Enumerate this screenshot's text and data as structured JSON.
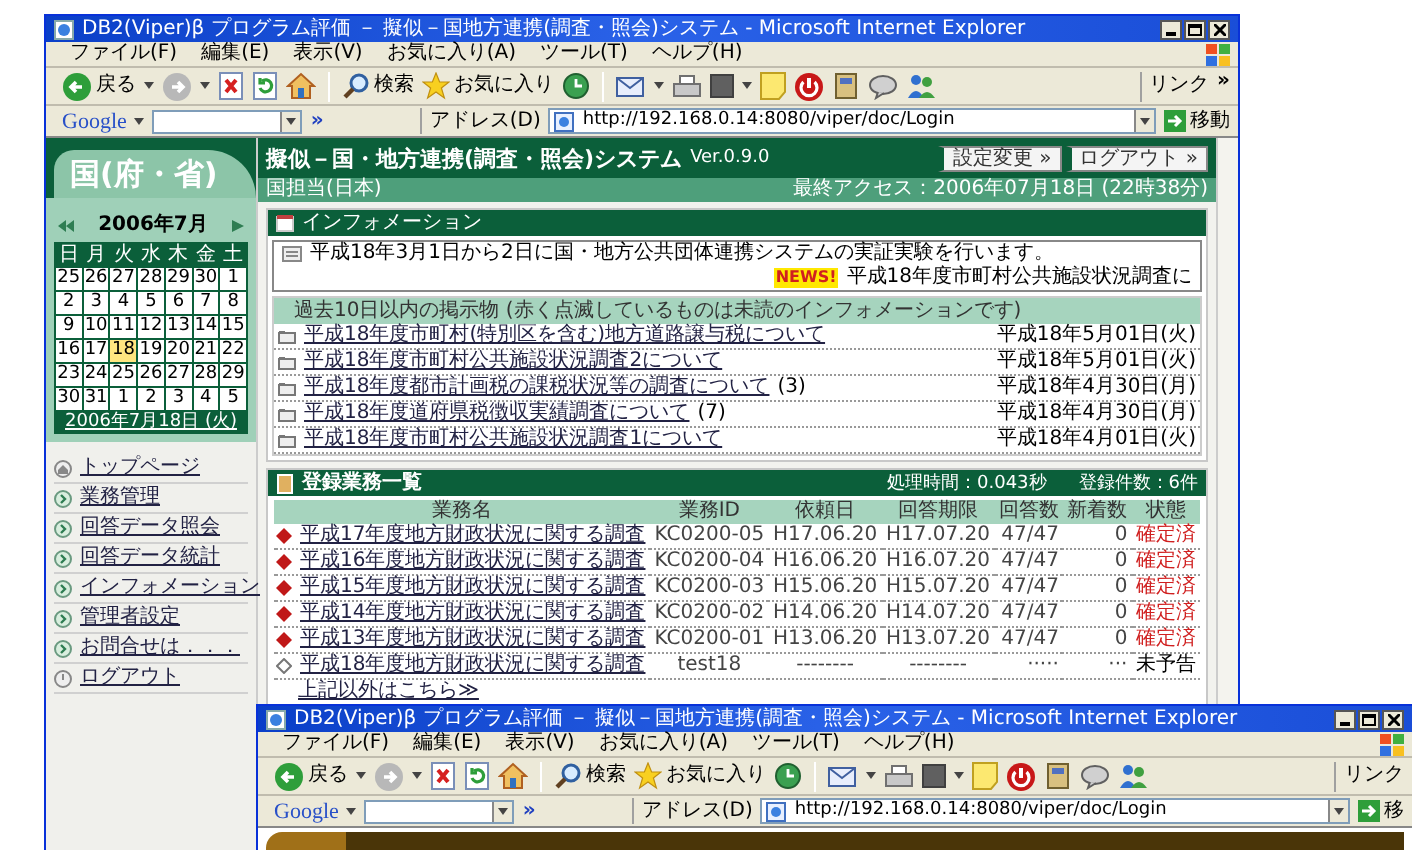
{
  "windows": [
    {
      "title": "DB2(Viper)β プログラム評価 － 擬似－国地方連携(調査・照会)システム - Microsoft Internet Explorer",
      "menu": [
        "ファイル(F)",
        "編集(E)",
        "表示(V)",
        "お気に入り(A)",
        "ツール(T)",
        "ヘルプ(H)"
      ],
      "toolbar": {
        "back": "戻る",
        "search": "検索",
        "favorites": "お気に入り",
        "links": "リンク",
        "links_more": "»"
      },
      "address_bar": {
        "google": "Google",
        "google_more": "»",
        "label": "アドレス(D)",
        "url": "http://192.168.0.14:8080/viper/doc/Login",
        "go": "移動"
      },
      "page": {
        "header": {
          "logo": "国(府・省)",
          "title": "擬似－国・地方連携(調査・照会)システム",
          "version": "Ver.0.9.0",
          "buttons": [
            "設定変更 »",
            "ログアウト »"
          ],
          "section": "国担当(日本)",
          "last_access": "最終アクセス：2006年07月18日 (22時38分)"
        },
        "calendar": {
          "month": "2006年7月",
          "weekdays": [
            "日",
            "月",
            "火",
            "水",
            "木",
            "金",
            "土"
          ],
          "weeks": [
            [
              {
                "day": "25",
                "selected": false
              },
              {
                "day": "26",
                "selected": false
              },
              {
                "day": "27",
                "selected": false
              },
              {
                "day": "28",
                "selected": false
              },
              {
                "day": "29",
                "selected": false
              },
              {
                "day": "30",
                "selected": false
              },
              {
                "day": "1",
                "selected": false
              }
            ],
            [
              {
                "day": "2",
                "selected": false
              },
              {
                "day": "3",
                "selected": false
              },
              {
                "day": "4",
                "selected": false
              },
              {
                "day": "5",
                "selected": false
              },
              {
                "day": "6",
                "selected": false
              },
              {
                "day": "7",
                "selected": false
              },
              {
                "day": "8",
                "selected": false
              }
            ],
            [
              {
                "day": "9",
                "selected": false
              },
              {
                "day": "10",
                "selected": false
              },
              {
                "day": "11",
                "selected": false
              },
              {
                "day": "12",
                "selected": false
              },
              {
                "day": "13",
                "selected": false
              },
              {
                "day": "14",
                "selected": false
              },
              {
                "day": "15",
                "selected": false
              }
            ],
            [
              {
                "day": "16",
                "selected": false
              },
              {
                "day": "17",
                "selected": false
              },
              {
                "day": "18",
                "selected": true
              },
              {
                "day": "19",
                "selected": false
              },
              {
                "day": "20",
                "selected": false
              },
              {
                "day": "21",
                "selected": false
              },
              {
                "day": "22",
                "selected": false
              }
            ],
            [
              {
                "day": "23",
                "selected": false
              },
              {
                "day": "24",
                "selected": false
              },
              {
                "day": "25",
                "selected": false
              },
              {
                "day": "26",
                "selected": false
              },
              {
                "day": "27",
                "selected": false
              },
              {
                "day": "28",
                "selected": false
              },
              {
                "day": "29",
                "selected": false
              }
            ],
            [
              {
                "day": "30",
                "selected": false
              },
              {
                "day": "31",
                "selected": false
              },
              {
                "day": "1",
                "selected": false
              },
              {
                "day": "2",
                "selected": false
              },
              {
                "day": "3",
                "selected": false
              },
              {
                "day": "4",
                "selected": false
              },
              {
                "day": "5",
                "selected": false
              }
            ]
          ],
          "footer": "2006年7月18日 (火)"
        },
        "nav": [
          {
            "label": "トップページ",
            "kind": "home"
          },
          {
            "label": "業務管理",
            "kind": "arrow"
          },
          {
            "label": "回答データ照会",
            "kind": "arrow"
          },
          {
            "label": "回答データ統計",
            "kind": "arrow"
          },
          {
            "label": "インフォメーション",
            "kind": "arrow"
          },
          {
            "label": "管理者設定",
            "kind": "arrow"
          },
          {
            "label": "お問合せは．．．",
            "kind": "arrow"
          },
          {
            "label": "ログアウト",
            "kind": "power"
          }
        ],
        "info": {
          "title": "インフォメーション",
          "notice": "平成18年3月1日から2日に国・地方公共団体連携システムの実証実験を行います。",
          "news_badge": "NEWS!",
          "news": "平成18年度市町村公共施設状況調査に",
          "subtitle": "過去10日以内の掲示物 (赤く点滅しているものは未読のインフォメーションです)",
          "items": [
            {
              "title": "平成18年度市町村(特別区を含む)地方道路譲与税について",
              "date": "平成18年5月01日(火)"
            },
            {
              "title": "平成18年度市町村公共施設状況調査2について",
              "date": "平成18年5月01日(火)"
            },
            {
              "title": "平成18年度都市計画税の課税状況等の調査について",
              "count": "(3)",
              "date": "平成18年4月30日(月)"
            },
            {
              "title": "平成18年度道府県税徴収実績調査について",
              "count": "(7)",
              "date": "平成18年4月30日(月)"
            },
            {
              "title": "平成18年度市町村公共施設状況調査1について",
              "date": "平成18年4月01日(火)"
            }
          ]
        },
        "tasks": {
          "title": "登録業務一覧",
          "time": "処理時間：0.043秒",
          "count": "登録件数：6件",
          "columns": [
            "業務名",
            "業務ID",
            "依頼日",
            "回答期限",
            "回答数",
            "新着数",
            "状態"
          ],
          "rows": [
            {
              "kind": "confirmed",
              "cells": [
                "平成17年度地方財政状況に関する調査",
                "KC0200-05",
                "H17.06.20",
                "H17.07.20",
                "47/47",
                "0",
                "確定済"
              ]
            },
            {
              "kind": "confirmed",
              "cells": [
                "平成16年度地方財政状況に関する調査",
                "KC0200-04",
                "H16.06.20",
                "H16.07.20",
                "47/47",
                "0",
                "確定済"
              ]
            },
            {
              "kind": "confirmed",
              "cells": [
                "平成15年度地方財政状況に関する調査",
                "KC0200-03",
                "H15.06.20",
                "H15.07.20",
                "47/47",
                "0",
                "確定済"
              ]
            },
            {
              "kind": "confirmed",
              "cells": [
                "平成14年度地方財政状況に関する調査",
                "KC0200-02",
                "H14.06.20",
                "H14.07.20",
                "47/47",
                "0",
                "確定済"
              ]
            },
            {
              "kind": "confirmed",
              "cells": [
                "平成13年度地方財政状況に関する調査",
                "KC0200-01",
                "H13.06.20",
                "H13.07.20",
                "47/47",
                "0",
                "確定済"
              ]
            },
            {
              "kind": "unannounced",
              "cells": [
                "平成18年度地方財政状況に関する調査",
                "test18",
                "--------",
                "--------",
                "·····",
                "···",
                "未予告"
              ]
            }
          ],
          "more": "上記以外はこちら≫"
        }
      }
    },
    {
      "title": "DB2(Viper)β プログラム評価 － 擬似－国地方連携(調査・照会)システム - Microsoft Internet Explorer",
      "menu": [
        "ファイル(F)",
        "編集(E)",
        "表示(V)",
        "お気に入り(A)",
        "ツール(T)",
        "ヘルプ(H)"
      ],
      "toolbar": {
        "back": "戻る",
        "search": "検索",
        "favorites": "お気に入り",
        "links": "リンク"
      },
      "address_bar": {
        "google": "Google",
        "google_more": "»",
        "label": "アドレス(D)",
        "url": "http://192.168.0.14:8080/viper/doc/Login",
        "go": "移"
      }
    }
  ]
}
